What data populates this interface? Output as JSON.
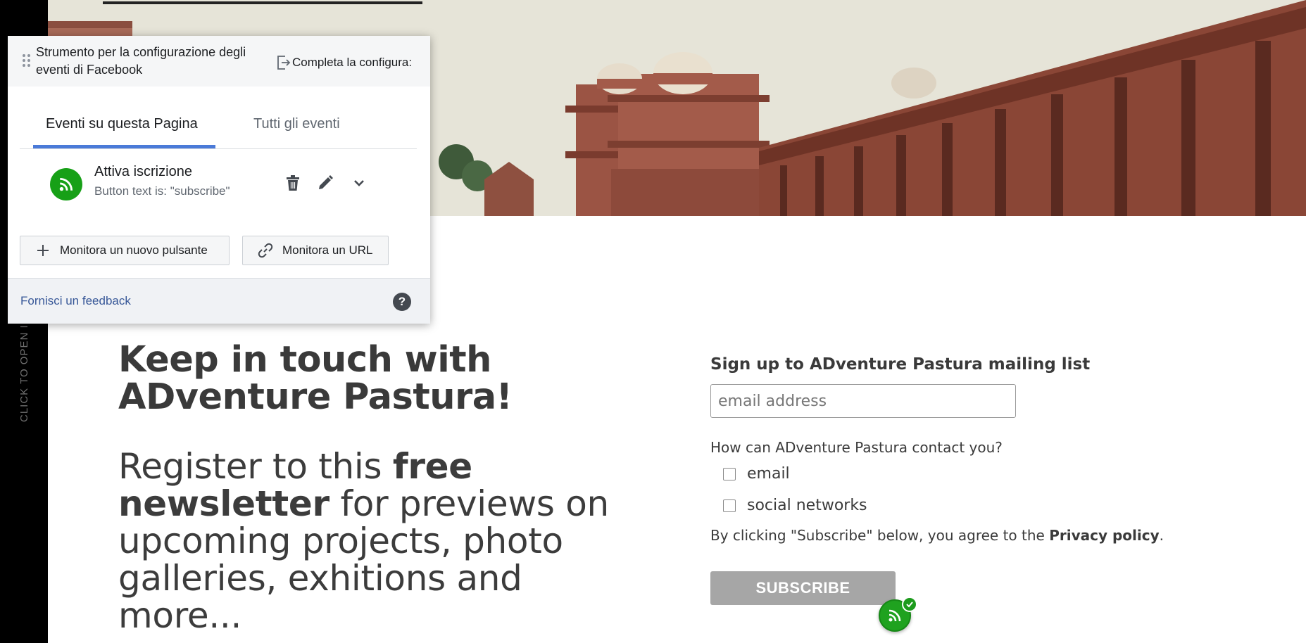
{
  "sidebar": {
    "vertical_label": "CLICK TO OPEN I"
  },
  "main": {
    "heading": "Keep in touch with ADventure Pastura!",
    "intro_part1": "Register to this ",
    "intro_bold": "free newsletter",
    "intro_part2": " for previews on upcoming projects, photo galleries, exhitions and more..."
  },
  "signup": {
    "title": "Sign up to ADventure Pastura mailing list",
    "email_placeholder": "email address",
    "email_value": "",
    "contact_question": "How can ADventure Pastura contact you?",
    "options": [
      "email",
      "social networks"
    ],
    "privacy_prefix": "By clicking \"Subscribe\" below, you agree to the ",
    "privacy_link": "Privacy policy",
    "privacy_suffix": ".",
    "subscribe_label": "SUBSCRIBE"
  },
  "fb_panel": {
    "title": "Strumento per la configurazione degli eventi di Facebook",
    "complete_label": "Completa la configura:",
    "tabs": [
      "Eventi su questa Pagina",
      "Tutti gli eventi"
    ],
    "active_tab": 0,
    "event": {
      "name": "Attiva iscrizione",
      "description": "Button text is: \"subscribe\""
    },
    "track_new_button": "Monitora un nuovo pulsante",
    "track_url_button": "Monitora un URL",
    "feedback_link": "Fornisci un feedback",
    "help_icon": "?"
  },
  "icons": {
    "drag": "drag-handle-icon",
    "exit": "exit-icon",
    "event": "rss-icon",
    "delete": "trash-icon",
    "edit": "pencil-icon",
    "expand": "chevron-down-icon",
    "add": "plus-icon",
    "link": "link-icon",
    "help": "help-icon",
    "check": "check-icon"
  },
  "colors": {
    "accent_blue": "#4a7ad8",
    "event_green": "#17a017",
    "link_blue": "#385898",
    "subscribe_gray": "#a6a6a6",
    "heading_text": "#3a3a3a"
  }
}
